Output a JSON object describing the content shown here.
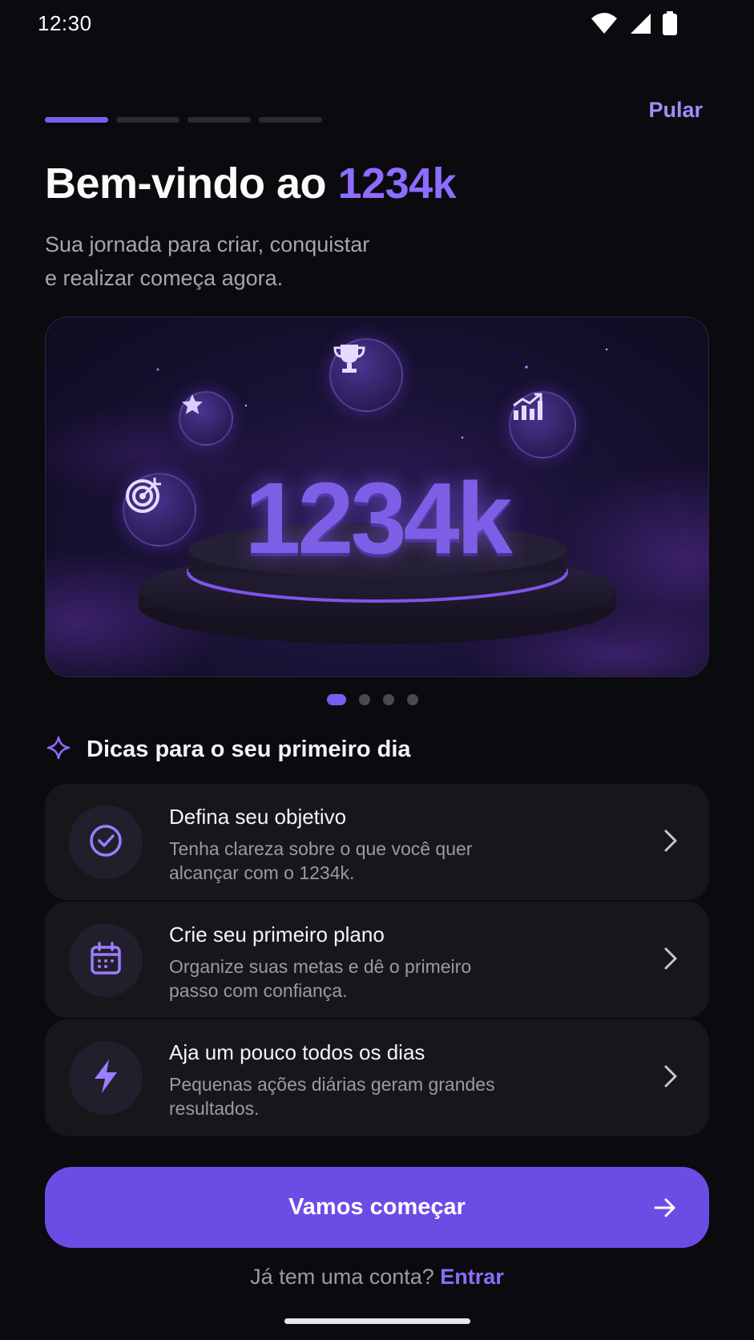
{
  "status_bar": {
    "time": "12:30"
  },
  "onboarding": {
    "step": 1,
    "total_steps": 4,
    "skip_label": "Pular"
  },
  "header": {
    "title_prefix": "Bem-vindo ao ",
    "title_brand": "1234k",
    "subtitle_line1": "Sua jornada para criar, conquistar",
    "subtitle_line2": "e realizar começa agora."
  },
  "hero": {
    "brand_text": "1234k",
    "icons": [
      "trophy-icon",
      "star-icon",
      "chart-growth-icon",
      "target-icon"
    ]
  },
  "carousel": {
    "current": 1,
    "count": 4
  },
  "tips": {
    "heading": "Dicas para o seu primeiro dia",
    "items": [
      {
        "icon": "check-circle-icon",
        "title": "Defina seu objetivo",
        "desc_line1": "Tenha clareza sobre o que você quer",
        "desc_line2": "alcançar com o 1234k."
      },
      {
        "icon": "calendar-icon",
        "title": "Crie seu primeiro plano",
        "desc_line1": "Organize suas metas e dê o primeiro",
        "desc_line2": "passo com confiança."
      },
      {
        "icon": "lightning-icon",
        "title": "Aja um pouco todos os dias",
        "desc_line1": "Pequenas ações diárias geram grandes",
        "desc_line2": "resultados."
      }
    ]
  },
  "cta": {
    "label": "Vamos começar"
  },
  "login": {
    "prompt": "Já tem uma conta? ",
    "link": "Entrar"
  },
  "colors": {
    "accent": "#7b5cf0",
    "accent_text": "#8d6cff",
    "background": "#0b0b0f",
    "card": "#16161b"
  }
}
